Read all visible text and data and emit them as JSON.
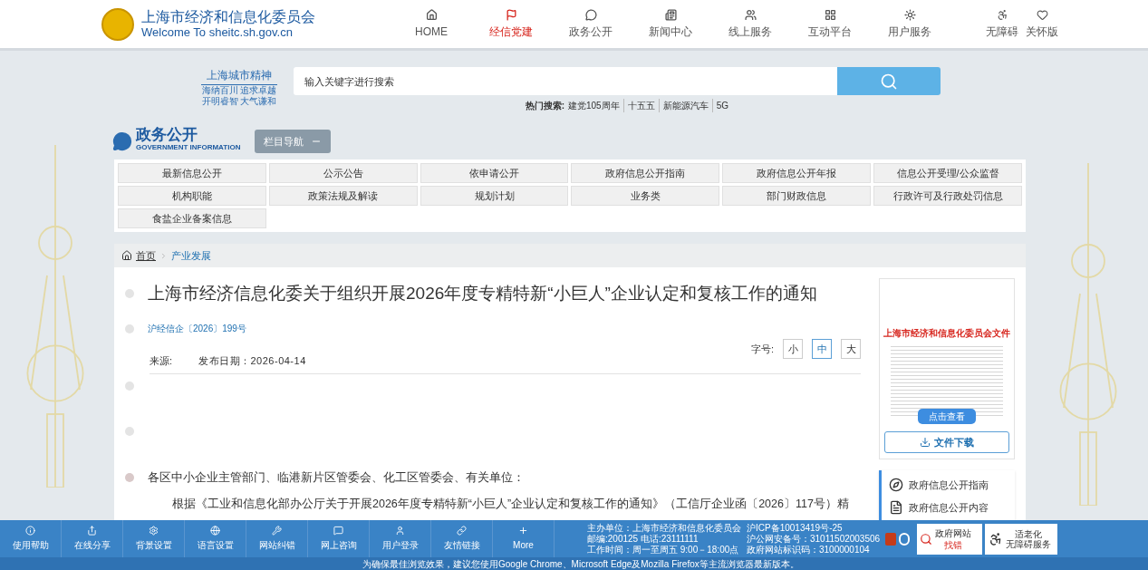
{
  "header": {
    "logo_title": "上海市经济和信息化委员会",
    "logo_subtitle": "Welcome To sheitc.sh.gov.cn",
    "nav": [
      {
        "label": "HOME",
        "selected": false
      },
      {
        "label": "经信党建",
        "selected": true
      },
      {
        "label": "政务公开",
        "selected": false
      },
      {
        "label": "新闻中心",
        "selected": false
      },
      {
        "label": "线上服务",
        "selected": false
      },
      {
        "label": "互动平台",
        "selected": false
      },
      {
        "label": "用户服务",
        "selected": false
      }
    ],
    "extra": [
      "无障碍",
      "关怀版"
    ]
  },
  "search": {
    "motto_title": "上海城市精神",
    "motto_lines": [
      "海纳百川 追求卓越",
      "开明睿智 大气谦和"
    ],
    "placeholder": "输入关键字进行搜索",
    "hot_label": "热门搜索:",
    "hot_terms": [
      "建党105周年",
      "十五五",
      "新能源汽车",
      "5G"
    ]
  },
  "section": {
    "title": "政务公开",
    "subtitle": "GOVERNMENT INFORMATION",
    "nav_button": "栏目导航",
    "expanded": true
  },
  "categories": [
    "最新信息公开",
    "公示公告",
    "依申请公开",
    "政府信息公开指南",
    "政府信息公开年报",
    "信息公开受理/公众监督",
    "机构职能",
    "政策法规及解读",
    "规划计划",
    "业务类",
    "部门财政信息",
    "行政许可及行政处罚信息",
    "食盐企业备案信息"
  ],
  "breadcrumb": [
    "首页",
    "产业发展"
  ],
  "article": {
    "title": "上海市经济信息化委关于组织开展2026年度专精特新“小巨人”企业认定和复核工作的通知",
    "doc_number": "沪经信企〔2026〕199号",
    "source_label": "来源:",
    "date": "发布日期：2026-04-14",
    "font_size_label": "字号:",
    "font_sizes": [
      {
        "label": "小",
        "selected": false
      },
      {
        "label": "中",
        "selected": true
      },
      {
        "label": "大",
        "selected": false
      }
    ],
    "paragraphs": [
      "各区中小企业主管部门、临港新片区管委会、化工区管委会、有关单位：",
      "根据《工业和信息化部办公厅关于开展2026年度专精特新“小巨人”企业认定和复核工作的通知》（工信厅企业函〔2026〕117号）精"
    ]
  },
  "sidebar": {
    "doc_heading": "上海市经济和信息化委员会文件",
    "view_button": "点击查看",
    "download_button": "文件下载",
    "links": [
      "政府信息公开指南",
      "政府信息公开内容"
    ]
  },
  "footer": {
    "tools": [
      "使用帮助",
      "在线分享",
      "背景设置",
      "语言设置",
      "网站纠错",
      "网上咨询",
      "用户登录",
      "友情链接",
      "More"
    ],
    "info_left": [
      "主办单位：上海市经济和信息化委员会",
      "邮编:200125 电话:23111111",
      "工作时间：周一至周五 9:00－18:00点"
    ],
    "info_right": [
      "沪ICP备10013419号-25",
      "沪公网安备号：31011502003506",
      "政府网站标识码：3100000104"
    ],
    "error_badge": [
      "政府网站",
      "找错"
    ],
    "elder_badge": [
      "适老化",
      "无障碍服务"
    ],
    "notice": "为确保最佳浏览效果，建议您使用Google Chrome、Microsoft Edge及Mozilla Firefox等主流浏览器最新版本。"
  }
}
